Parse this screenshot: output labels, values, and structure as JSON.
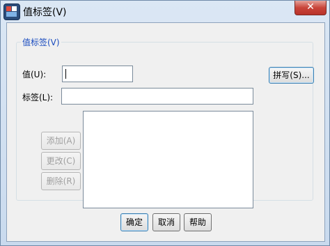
{
  "window": {
    "title": "值标签(V)",
    "close_glyph": "✕"
  },
  "group": {
    "legend": "值标签(V)"
  },
  "value_field": {
    "label": "值(U):",
    "value": ""
  },
  "label_field": {
    "label": "标签(L):",
    "value": ""
  },
  "spelling_button": "拼写(S)...",
  "list_buttons": {
    "add": "添加(A)",
    "change": "更改(C)",
    "remove": "删除(R)"
  },
  "footer": {
    "ok": "确定",
    "cancel": "取消",
    "help": "帮助"
  },
  "icons": {
    "app": "spss-value-labels-icon",
    "close": "close-icon"
  }
}
